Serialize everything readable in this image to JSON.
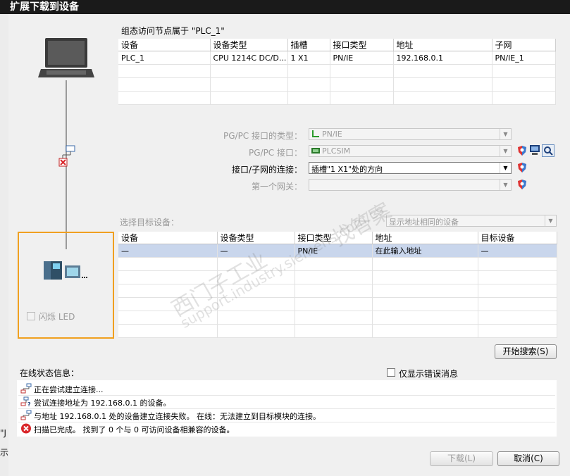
{
  "window": {
    "title": "扩展下载到设备"
  },
  "outside": {
    "char1": "\"J",
    "char2": "示"
  },
  "devices": {
    "header": "组态访问节点属于 \"PLC_1\"",
    "columns": [
      "设备",
      "设备类型",
      "插槽",
      "接口类型",
      "地址",
      "子网"
    ],
    "rows": [
      [
        "PLC_1",
        "CPU 1214C DC/D...",
        "1 X1",
        "PN/IE",
        "192.168.0.1",
        "PN/IE_1"
      ]
    ]
  },
  "interface": {
    "pgpc_type_label": "PG/PC 接口的类型：",
    "pgpc_type_value": "PN/IE",
    "pgpc_label": "PG/PC 接口：",
    "pgpc_value": "PLCSIM",
    "subnet_label": "接口/子网的连接：",
    "subnet_value": "插槽\"1 X1\"处的方向",
    "gateway_label": "第一个网关：",
    "gateway_value": ""
  },
  "target": {
    "label": "选择目标设备：",
    "filter_value": "显示地址相同的设备",
    "columns": [
      "设备",
      "设备类型",
      "接口类型",
      "地址",
      "目标设备"
    ],
    "rows": [
      [
        "—",
        "—",
        "PN/IE",
        "在此输入地址",
        "—"
      ]
    ]
  },
  "flash_led_label": "闪烁 LED",
  "start_search_label": "开始搜索(S)",
  "status": {
    "title": "在线状态信息：",
    "errors_only_label": "仅显示错误消息",
    "messages": [
      {
        "icon": "network-icon",
        "text": "正在尝试建立连接..."
      },
      {
        "icon": "network-question-icon",
        "text": "尝试连接地址为 192.168.0.1 的设备。"
      },
      {
        "icon": "network-icon",
        "text": "与地址 192.168.0.1 处的设备建立连接失败。 在线：无法建立到目标模块的连接。"
      },
      {
        "icon": "error-icon",
        "text": "扫描已完成。 找到了 0 个与 0 可访问设备相兼容的设备。"
      }
    ]
  },
  "buttons": {
    "download": "下载(L)",
    "cancel": "取消(C)"
  },
  "watermark": {
    "line1": "西门子工业",
    "line2": "support.industry.siemens.com/cs",
    "line3": "找答案"
  },
  "colors": {
    "selection": "#c9d6ec",
    "highlight_border": "#f0a020",
    "error_red": "#d9262a"
  }
}
